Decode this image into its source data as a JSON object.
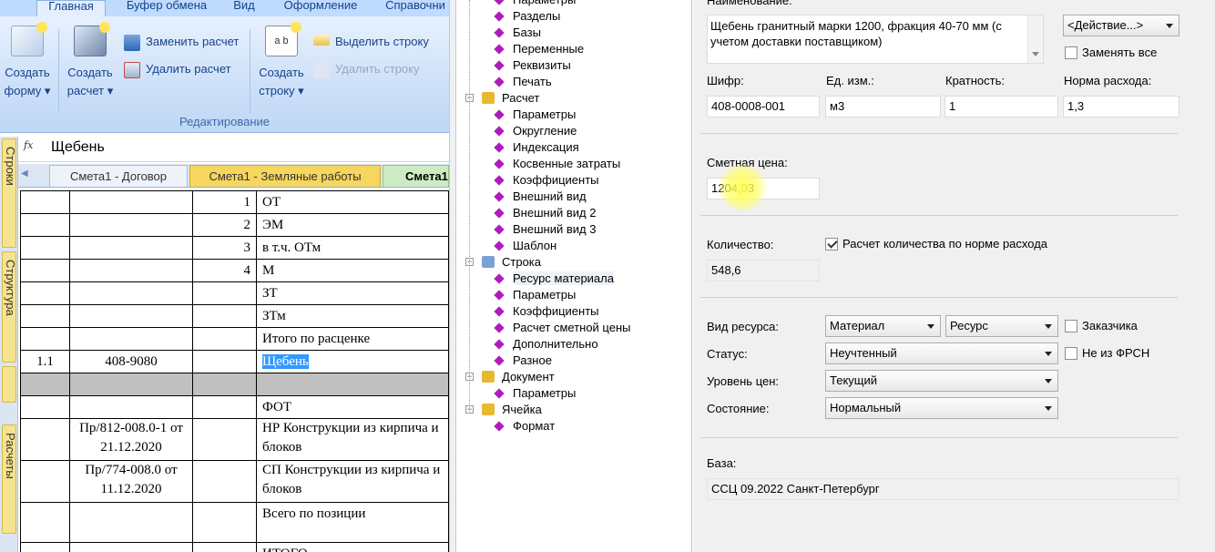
{
  "ribbon": {
    "tabs": [
      "Главная",
      "Буфер обмена",
      "Вид",
      "Оформление",
      "Справочни"
    ],
    "active_tab": "Главная",
    "big_buttons": [
      {
        "label": "Создать",
        "sub": "форму ▾"
      },
      {
        "label": "Создать",
        "sub": "расчет ▾"
      },
      {
        "label": "Создать",
        "sub": "строку ▾"
      }
    ],
    "small_buttons": {
      "replace_calc": "Заменить расчет",
      "delete_calc": "Удалить расчет",
      "select_row": "Выделить строку",
      "delete_row": "Удалить строку"
    },
    "group_label": "Редактирование"
  },
  "formula_bar": {
    "fx": "fx",
    "value": "Щебень"
  },
  "sheet_tabs": [
    "Смета1 - Договор",
    "Смета1 - Земляные работы",
    "Смета1"
  ],
  "side_tabs": [
    "Строки",
    "Структура",
    "Расчеты"
  ],
  "grid": {
    "rows": [
      {
        "c1": "",
        "c2": "",
        "c3": "1",
        "c4": "ОТ"
      },
      {
        "c1": "",
        "c2": "",
        "c3": "2",
        "c4": "ЭМ"
      },
      {
        "c1": "",
        "c2": "",
        "c3": "3",
        "c4": "в т.ч. ОТм"
      },
      {
        "c1": "",
        "c2": "",
        "c3": "4",
        "c4": "М"
      },
      {
        "c1": "",
        "c2": "",
        "c3": "",
        "c4": "ЗТ"
      },
      {
        "c1": "",
        "c2": "",
        "c3": "",
        "c4": "ЗТм"
      },
      {
        "c1": "",
        "c2": "",
        "c3": "",
        "c4": "Итого по расценке"
      },
      {
        "c1": "1.1",
        "c2": "408-9080",
        "c3": "",
        "c4": "Щебень"
      },
      {
        "c1": "",
        "c2": "",
        "c3": "",
        "c4": ""
      },
      {
        "c1": "",
        "c2": "",
        "c3": "",
        "c4": "ФОТ"
      },
      {
        "c1": "",
        "c2": "Пр/812-008.0-1 от 21.12.2020",
        "c3": "",
        "c4": "НР Конструкции из кирпича и блоков"
      },
      {
        "c1": "",
        "c2": "Пр/774-008.0 от 11.12.2020",
        "c3": "",
        "c4": "СП Конструкции из кирпича и блоков"
      },
      {
        "c1": "",
        "c2": "",
        "c3": "",
        "c4": "Всего по позиции"
      },
      {
        "c1": "",
        "c2": "",
        "c3": "",
        "c4": "ИТОГО"
      }
    ]
  },
  "tree": {
    "nodes": [
      {
        "label": "Параметры",
        "level": 2
      },
      {
        "label": "Разделы",
        "level": 2
      },
      {
        "label": "Базы",
        "level": 2
      },
      {
        "label": "Переменные",
        "level": 2
      },
      {
        "label": "Реквизиты",
        "level": 2
      },
      {
        "label": "Печать",
        "level": 2
      },
      {
        "label": "Расчет",
        "level": 1
      },
      {
        "label": "Параметры",
        "level": 2
      },
      {
        "label": "Округление",
        "level": 2
      },
      {
        "label": "Индексация",
        "level": 2
      },
      {
        "label": "Косвенные затраты",
        "level": 2
      },
      {
        "label": "Коэффициенты",
        "level": 2
      },
      {
        "label": "Внешний вид",
        "level": 2
      },
      {
        "label": "Внешний вид 2",
        "level": 2
      },
      {
        "label": "Внешний вид 3",
        "level": 2
      },
      {
        "label": "Шаблон",
        "level": 2
      },
      {
        "label": "Строка",
        "level": 1
      },
      {
        "label": "Ресурс материала",
        "level": 2
      },
      {
        "label": "Параметры",
        "level": 2
      },
      {
        "label": "Коэффициенты",
        "level": 2
      },
      {
        "label": "Расчет сметной цены",
        "level": 2
      },
      {
        "label": "Дополнительно",
        "level": 2
      },
      {
        "label": "Разное",
        "level": 2
      },
      {
        "label": "Документ",
        "level": 1
      },
      {
        "label": "Параметры",
        "level": 2
      },
      {
        "label": "Ячейка",
        "level": 1
      },
      {
        "label": "Формат",
        "level": 2
      }
    ]
  },
  "props": {
    "name_label": "Наименование:",
    "name_value": "Щебень гранитный марки 1200, фракция 40-70 мм (с учетом доставки поставщиком)",
    "action_combo": "<Действие...>",
    "replace_all": "Заменять все",
    "code_label": "Шифр:",
    "code_value": "408-0008-001",
    "unit_label": "Ед. изм.:",
    "unit_value": "м3",
    "multiplicity_label": "Кратность:",
    "multiplicity_value": "1",
    "norm_label": "Норма расхода:",
    "norm_value": "1,3",
    "price_label": "Сметная цена:",
    "price_value": "1204,03",
    "qty_label": "Количество:",
    "qty_check": "Расчет количества по норме расхода",
    "qty_value": "548,6",
    "resource_type_label": "Вид ресурса:",
    "resource_type_value": "Материал",
    "resource_value": "Ресурс",
    "customer_check": "Заказчика",
    "status_label": "Статус:",
    "status_value": "Неучтенный",
    "not_frsn_check": "Не из ФРСН",
    "price_level_label": "Уровень цен:",
    "price_level_value": "Текущий",
    "state_label": "Состояние:",
    "state_value": "Нормальный",
    "base_label": "База:",
    "base_value": "ССЦ 09.2022 Санкт-Петербург"
  }
}
